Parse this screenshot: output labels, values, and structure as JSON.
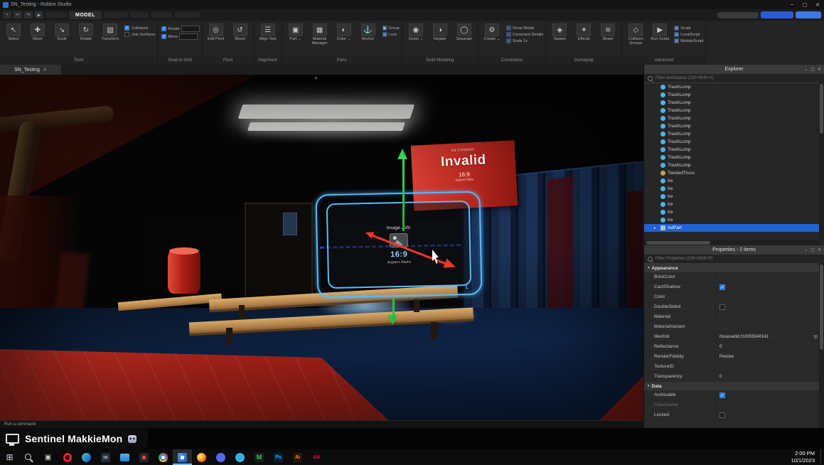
{
  "window": {
    "title": "SN_Testing - Roblox Studio",
    "minimize": "–",
    "maximize": "▢",
    "close": "✕"
  },
  "menubar": {
    "active_tab": "MODEL"
  },
  "ribbon": {
    "groups": [
      {
        "label": "Tools",
        "items": [
          {
            "k": "big",
            "g": "↖",
            "l": "Select"
          },
          {
            "k": "big",
            "g": "✚",
            "l": "Move"
          },
          {
            "k": "big",
            "g": "↘",
            "l": "Scale"
          },
          {
            "k": "big",
            "g": "↻",
            "l": "Rotate"
          },
          {
            "k": "big",
            "g": "▧",
            "l": "Transform"
          },
          {
            "k": "col",
            "items": [
              {
                "k": "check",
                "l": "Collisions",
                "c": true
              },
              {
                "k": "check",
                "l": "Join Surfaces",
                "c": false
              }
            ]
          }
        ]
      },
      {
        "label": "Snap to Grid",
        "items": [
          {
            "k": "col",
            "items": [
              {
                "k": "field",
                "l": "Rotate",
                "v": "",
                "c": true
              },
              {
                "k": "field",
                "l": "Move",
                "v": "",
                "c": true
              }
            ]
          }
        ]
      },
      {
        "label": "Pivot",
        "items": [
          {
            "k": "big",
            "g": "◎",
            "l": "Edit Pivot"
          },
          {
            "k": "big",
            "g": "↺",
            "l": "Reset"
          }
        ]
      },
      {
        "label": "Alignment",
        "items": [
          {
            "k": "big",
            "g": "☰",
            "l": "Align Tool"
          }
        ]
      },
      {
        "label": "Parts",
        "items": [
          {
            "k": "big",
            "g": "▣",
            "l": "Part",
            "dd": true
          },
          {
            "k": "big",
            "g": "▦",
            "l": "Material Manager"
          },
          {
            "k": "big",
            "g": "◐",
            "l": "Color",
            "dd": true
          },
          {
            "k": "big",
            "g": "⚓",
            "l": "Anchor"
          },
          {
            "k": "col",
            "items": [
              {
                "k": "small",
                "g": "▣",
                "l": "Group"
              },
              {
                "k": "small",
                "g": "⊠",
                "l": "Lock"
              }
            ]
          }
        ]
      },
      {
        "label": "Solid Modeling",
        "items": [
          {
            "k": "big",
            "g": "◉",
            "l": "Union",
            "dd": true
          },
          {
            "k": "big",
            "g": "◑",
            "l": "Negate"
          },
          {
            "k": "big",
            "g": "◯",
            "l": "Separate"
          }
        ]
      },
      {
        "label": "Constraints",
        "items": [
          {
            "k": "big",
            "g": "⚙",
            "l": "Create",
            "dd": true
          },
          {
            "k": "col",
            "items": [
              {
                "k": "small",
                "g": "▫",
                "l": "Show Welds"
              },
              {
                "k": "small",
                "g": "▫",
                "l": "Constraint Details"
              },
              {
                "k": "small",
                "g": "▫",
                "l": "Scale 1x"
              }
            ]
          }
        ]
      },
      {
        "label": "Gameplay",
        "items": [
          {
            "k": "big",
            "g": "◈",
            "l": "Spawn"
          },
          {
            "k": "big",
            "g": "✶",
            "l": "Effects"
          },
          {
            "k": "big",
            "g": "≋",
            "l": "Beam"
          }
        ]
      },
      {
        "label": "Advanced",
        "items": [
          {
            "k": "big",
            "g": "◇",
            "l": "Collision Groups"
          },
          {
            "k": "big",
            "g": "▶",
            "l": "Run Script"
          },
          {
            "k": "col",
            "items": [
              {
                "k": "small",
                "g": "▤",
                "l": "Script"
              },
              {
                "k": "small",
                "g": "▤",
                "l": "LocalScript"
              },
              {
                "k": "small",
                "g": "▤",
                "l": "ModuleScript"
              }
            ]
          }
        ]
      }
    ]
  },
  "dock": {
    "tab_label": "SN_Testing",
    "close": "✕"
  },
  "viewport": {
    "crosshair": "+",
    "ad_sign": {
      "kicker": "Ad Container",
      "title": "Invalid",
      "ratio": "16:9",
      "ratio_label": "Aspect Ratio"
    },
    "selection": {
      "title": "Image Ads",
      "ratio": "16:9",
      "ratio_label": "Aspect Ratio"
    },
    "axis_label": "L",
    "command_bar": "Run a command"
  },
  "overlay": {
    "badge": "Sentinel MakkieMon"
  },
  "explorer": {
    "title": "Explorer",
    "filter_placeholder": "Filter workspace (Ctrl+Shift+X)",
    "items": [
      {
        "label": "TrashLump",
        "icon": "mesh"
      },
      {
        "label": "TrashLump",
        "icon": "mesh"
      },
      {
        "label": "TrashLump",
        "icon": "mesh"
      },
      {
        "label": "TrashLump",
        "icon": "mesh"
      },
      {
        "label": "TrashLump",
        "icon": "mesh"
      },
      {
        "label": "TrashLump",
        "icon": "mesh"
      },
      {
        "label": "TrashLump",
        "icon": "mesh"
      },
      {
        "label": "TrashLump",
        "icon": "mesh"
      },
      {
        "label": "TrashLump",
        "icon": "mesh"
      },
      {
        "label": "TrashLump",
        "icon": "mesh"
      },
      {
        "label": "TrashLump",
        "icon": "mesh"
      },
      {
        "label": "TwistedTruss",
        "icon": "truss"
      },
      {
        "label": "tre",
        "icon": "model"
      },
      {
        "label": "tre",
        "icon": "model"
      },
      {
        "label": "tre",
        "icon": "model"
      },
      {
        "label": "tre",
        "icon": "model"
      },
      {
        "label": "tre",
        "icon": "model"
      },
      {
        "label": "tre",
        "icon": "model"
      },
      {
        "label": "AdPart",
        "icon": "part",
        "selected": true,
        "expander": true
      }
    ]
  },
  "properties": {
    "title": "Properties - 2 items",
    "filter_placeholder": "Filter Properties (Ctrl+Shift+P)",
    "sections": [
      {
        "label": "Appearance",
        "rows": [
          {
            "label": "BrickColor",
            "type": "text",
            "value": ""
          },
          {
            "label": "CastShadow",
            "type": "checkbox",
            "checked": true
          },
          {
            "label": "Color",
            "type": "text",
            "value": ""
          },
          {
            "label": "DoubleSided",
            "type": "checkbox",
            "checked": false
          },
          {
            "label": "Material",
            "type": "text",
            "value": ""
          },
          {
            "label": "MaterialVariant",
            "type": "text",
            "value": ""
          },
          {
            "label": "MeshId",
            "type": "asset",
            "value": "rbxassetid://10055340141"
          },
          {
            "label": "Reflectance",
            "type": "text",
            "value": "0"
          },
          {
            "label": "RenderFidelity",
            "type": "text",
            "value": "Precise"
          },
          {
            "label": "TextureID",
            "type": "text",
            "value": ""
          },
          {
            "label": "Transparency",
            "type": "text",
            "value": "0"
          }
        ]
      },
      {
        "label": "Data",
        "rows": [
          {
            "label": "Archivable",
            "type": "checkbox",
            "checked": true
          },
          {
            "label": "ClassName",
            "type": "text",
            "value": "",
            "dim": true
          },
          {
            "label": "Locked",
            "type": "checkbox",
            "checked": false
          }
        ]
      }
    ]
  },
  "taskbar": {
    "icons": [
      {
        "name": "start",
        "kind": "start"
      },
      {
        "name": "search",
        "kind": "lens"
      },
      {
        "name": "task-view",
        "kind": "taskview"
      },
      {
        "name": "opera",
        "kind": "opera"
      },
      {
        "name": "edge",
        "kind": "edge"
      },
      {
        "name": "mail",
        "kind": "mail"
      },
      {
        "name": "file-explorer",
        "kind": "files"
      },
      {
        "name": "media-player",
        "kind": "media"
      },
      {
        "name": "chrome",
        "kind": "chrome"
      },
      {
        "name": "roblox-studio",
        "kind": "roblox",
        "active": true
      },
      {
        "name": "firefox",
        "kind": "firefox"
      },
      {
        "name": "discord",
        "kind": "discord"
      },
      {
        "name": "skype",
        "kind": "skype"
      },
      {
        "name": "m-app",
        "kind": "mapp",
        "text": "M"
      },
      {
        "name": "photoshop",
        "kind": "ps",
        "text": "Ps"
      },
      {
        "name": "illustrator",
        "kind": "ai",
        "text": "Ai"
      },
      {
        "name": "opera-gx",
        "kind": "gx",
        "text": "GX"
      }
    ],
    "clock": {
      "time": "2:00 PM",
      "date": "10/1/2023"
    }
  },
  "colors": {
    "accent_blue": "#1f62d4",
    "selection_outline": "#59bcff",
    "axis_green": "#2fd14f",
    "axis_red": "#ee3528",
    "axis_blue": "#2d49d0",
    "sign_red": "#c22b22",
    "checkbox_blue": "#2f7fd6"
  }
}
